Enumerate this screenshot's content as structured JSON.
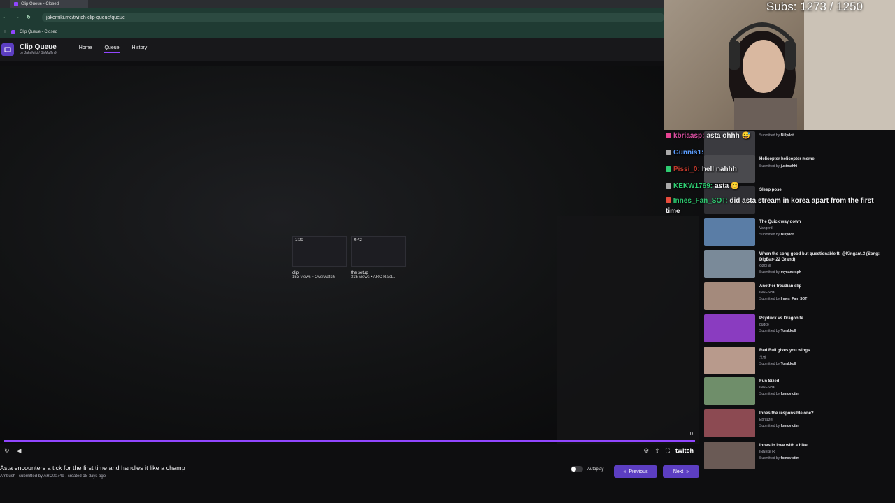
{
  "browser": {
    "tab_title": "Clip Queue - Closed",
    "url": "jakemiki.me/twitch-clip-queue/queue",
    "bookmark": "Clip Queue - Closed"
  },
  "app": {
    "title": "Clip Queue",
    "byline": "by  JakeMiki / SirMuffin9",
    "nav": [
      "Home",
      "Queue",
      "History"
    ]
  },
  "player": {
    "progress_count": "0",
    "progress_fraction": 1.0,
    "overlay_clips": [
      {
        "duration": "1:00",
        "title": "clip",
        "meta": "153 views • Overwatch"
      },
      {
        "duration": "0:42",
        "title": "the setup",
        "meta": "335 views • ARC Raid..."
      }
    ],
    "brand": "twitch"
  },
  "current_clip": {
    "title": "Asta encounters a tick for the first time and handles it like a champ",
    "meta": "Ambush , submitted by ARC00749 , created 18 days ago"
  },
  "controls": {
    "autoplay_label": "Autoplay",
    "previous_label": "Previous",
    "next_label": "Next"
  },
  "overlay": {
    "subs": "Subs: 1273 / 1250"
  },
  "chat": [
    {
      "user": "kbriaasp:",
      "color": "#d94fa0",
      "text": "asta ohhh 😅"
    },
    {
      "user": "Gunnis1:",
      "color": "#5b9dfe",
      "text": ""
    },
    {
      "user": "Pissi_0:",
      "color": "#c0392b",
      "text": "hell nahhh"
    },
    {
      "user": "KEKW1769:",
      "color": "#2ecc71",
      "text": "asta 😊"
    },
    {
      "user": "Innes_Fan_SOT:",
      "color": "#2ecc71",
      "text": "did asta stream in korea apart from the first time"
    }
  ],
  "queue": [
    {
      "title": "",
      "channel": "",
      "submitter": "Billydot",
      "img": "#3b3b40"
    },
    {
      "title": "Helicopter helicopter meme",
      "channel": "",
      "submitter": "justmahhi",
      "img": "#4a4a4e"
    },
    {
      "title": "Sleep pose",
      "channel": "",
      "submitter": "",
      "img": "#2f2f34"
    },
    {
      "title": "The Quick way down",
      "channel": "Vangerd",
      "submitter": "Billydot",
      "img": "#5a7da6"
    },
    {
      "title": "When the song good but questionable ft. @Kingant.3 (Song: DigBar- 22 Grand)",
      "channel": "G2Chill",
      "submitter": "mynamesph",
      "img": "#7a8a99"
    },
    {
      "title": "Another freudian slip",
      "channel": "INNESHX",
      "submitter": "Innes_Fan_SOT",
      "img": "#a48a7c"
    },
    {
      "title": "Psyduck vs Dragonite",
      "channel": "quqco",
      "submitter": "Torakkoll",
      "img": "#8a3cc0"
    },
    {
      "title": "Red Bull gives you wings",
      "channel": "芝他",
      "submitter": "Torakkoll",
      "img": "#b89a8c"
    },
    {
      "title": "Fun Sized",
      "channel": "INNESHX",
      "submitter": "fomovictim",
      "img": "#6f8e6a"
    },
    {
      "title": "Innes the responsible one?",
      "channel": "Ebruzzer",
      "submitter": "fomovictim",
      "img": "#8c4a52"
    },
    {
      "title": "Innes in love with a bike",
      "channel": "INNESHX",
      "submitter": "fomovictim",
      "img": "#6a5a55"
    }
  ],
  "colors": {
    "accent": "#9146ff",
    "button": "#5c3ec2"
  }
}
